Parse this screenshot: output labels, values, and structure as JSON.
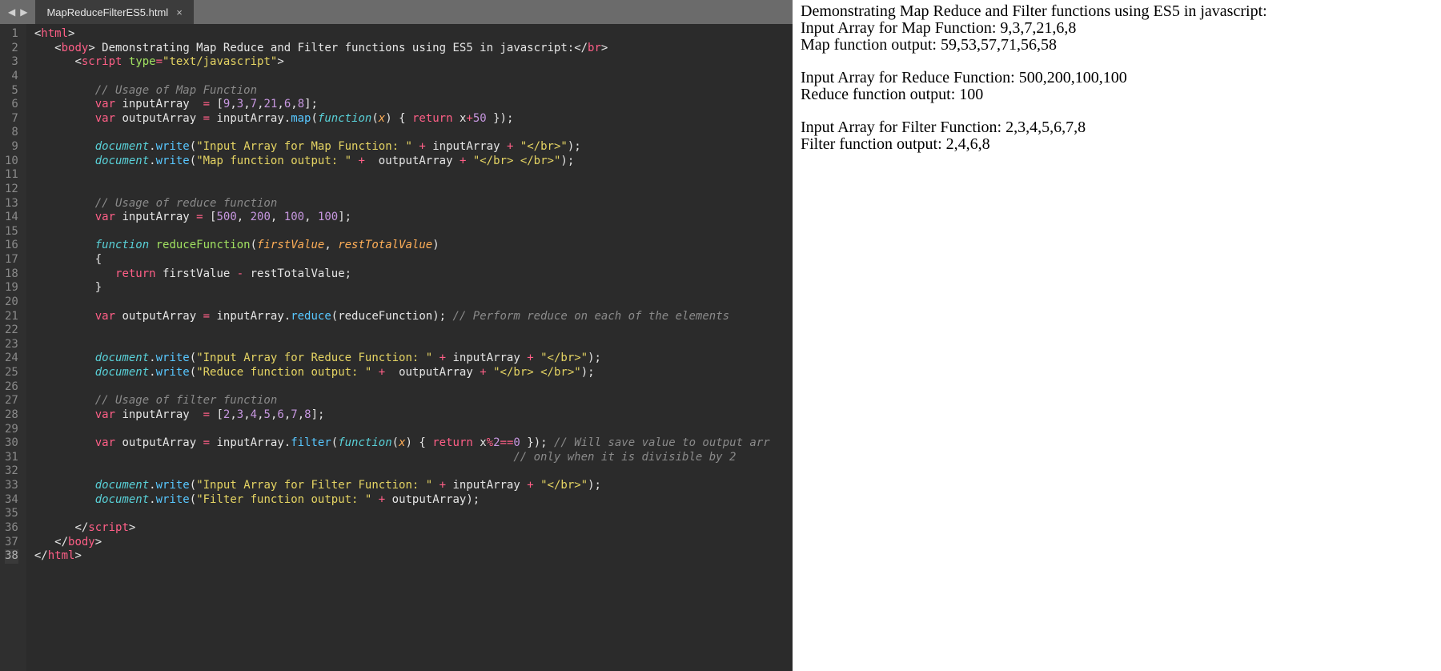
{
  "tab": {
    "title": "MapReduceFilterES5.html",
    "close_glyph": "×"
  },
  "nav": {
    "left": "◀",
    "right": "▶"
  },
  "gutter_lines": 38,
  "code_lines": [
    [
      [
        "c-punc",
        "<"
      ],
      [
        "c-tag",
        "html"
      ],
      [
        "c-punc",
        ">"
      ]
    ],
    [
      [
        "",
        "   "
      ],
      [
        "c-punc",
        "<"
      ],
      [
        "c-tag",
        "body"
      ],
      [
        "c-punc",
        "> "
      ],
      [
        "c-default",
        "Demonstrating Map Reduce and Filter functions using ES5 in javascript:"
      ],
      [
        "c-punc",
        "</"
      ],
      [
        "c-tag",
        "br"
      ],
      [
        "c-punc",
        ">"
      ]
    ],
    [
      [
        "",
        "      "
      ],
      [
        "c-punc",
        "<"
      ],
      [
        "c-tag",
        "script "
      ],
      [
        "c-attr",
        "type"
      ],
      [
        "c-op",
        "="
      ],
      [
        "c-string",
        "\"text/javascript\""
      ],
      [
        "c-punc",
        ">"
      ]
    ],
    [
      [
        "",
        ""
      ]
    ],
    [
      [
        "",
        "         "
      ],
      [
        "c-comment",
        "// Usage of Map Function"
      ]
    ],
    [
      [
        "",
        "         "
      ],
      [
        "c-tag",
        "var"
      ],
      [
        "c-default",
        " inputArray  "
      ],
      [
        "c-op",
        "="
      ],
      [
        "c-default",
        " ["
      ],
      [
        "c-num",
        "9"
      ],
      [
        "c-punc",
        ","
      ],
      [
        "c-num",
        "3"
      ],
      [
        "c-punc",
        ","
      ],
      [
        "c-num",
        "7"
      ],
      [
        "c-punc",
        ","
      ],
      [
        "c-num",
        "21"
      ],
      [
        "c-punc",
        ","
      ],
      [
        "c-num",
        "6"
      ],
      [
        "c-punc",
        ","
      ],
      [
        "c-num",
        "8"
      ],
      [
        "c-default",
        "];"
      ]
    ],
    [
      [
        "",
        "         "
      ],
      [
        "c-tag",
        "var"
      ],
      [
        "c-default",
        " outputArray "
      ],
      [
        "c-op",
        "="
      ],
      [
        "c-default",
        " inputArray."
      ],
      [
        "c-method",
        "map"
      ],
      [
        "c-default",
        "("
      ],
      [
        "c-func-it",
        "function"
      ],
      [
        "c-default",
        "("
      ],
      [
        "c-param",
        "x"
      ],
      [
        "c-default",
        ") { "
      ],
      [
        "c-tag",
        "return"
      ],
      [
        "c-default",
        " x"
      ],
      [
        "c-op",
        "+"
      ],
      [
        "c-num",
        "50"
      ],
      [
        "c-default",
        " });"
      ]
    ],
    [
      [
        "",
        ""
      ]
    ],
    [
      [
        "",
        "         "
      ],
      [
        "c-func-it",
        "document"
      ],
      [
        "c-default",
        "."
      ],
      [
        "c-method",
        "write"
      ],
      [
        "c-default",
        "("
      ],
      [
        "c-string",
        "\"Input Array for Map Function: \""
      ],
      [
        "c-default",
        " "
      ],
      [
        "c-op",
        "+"
      ],
      [
        "c-default",
        " inputArray "
      ],
      [
        "c-op",
        "+"
      ],
      [
        "c-default",
        " "
      ],
      [
        "c-string",
        "\"</br>\""
      ],
      [
        "c-default",
        ");"
      ]
    ],
    [
      [
        "",
        "         "
      ],
      [
        "c-func-it",
        "document"
      ],
      [
        "c-default",
        "."
      ],
      [
        "c-method",
        "write"
      ],
      [
        "c-default",
        "("
      ],
      [
        "c-string",
        "\"Map function output: \""
      ],
      [
        "c-default",
        " "
      ],
      [
        "c-op",
        "+"
      ],
      [
        "c-default",
        "  outputArray "
      ],
      [
        "c-op",
        "+"
      ],
      [
        "c-default",
        " "
      ],
      [
        "c-string",
        "\"</br> </br>\""
      ],
      [
        "c-default",
        ");"
      ]
    ],
    [
      [
        "",
        ""
      ]
    ],
    [
      [
        "",
        ""
      ]
    ],
    [
      [
        "",
        "         "
      ],
      [
        "c-comment",
        "// Usage of reduce function"
      ]
    ],
    [
      [
        "",
        "         "
      ],
      [
        "c-tag",
        "var"
      ],
      [
        "c-default",
        " inputArray "
      ],
      [
        "c-op",
        "="
      ],
      [
        "c-default",
        " ["
      ],
      [
        "c-num",
        "500"
      ],
      [
        "c-punc",
        ", "
      ],
      [
        "c-num",
        "200"
      ],
      [
        "c-punc",
        ", "
      ],
      [
        "c-num",
        "100"
      ],
      [
        "c-punc",
        ", "
      ],
      [
        "c-num",
        "100"
      ],
      [
        "c-default",
        "];"
      ]
    ],
    [
      [
        "",
        ""
      ]
    ],
    [
      [
        "",
        "         "
      ],
      [
        "c-func-it",
        "function"
      ],
      [
        "c-default",
        " "
      ],
      [
        "c-attr",
        "reduceFunction"
      ],
      [
        "c-default",
        "("
      ],
      [
        "c-param",
        "firstValue"
      ],
      [
        "c-punc",
        ", "
      ],
      [
        "c-param",
        "restTotalValue"
      ],
      [
        "c-default",
        ")"
      ]
    ],
    [
      [
        "",
        "         {"
      ]
    ],
    [
      [
        "",
        "            "
      ],
      [
        "c-tag",
        "return"
      ],
      [
        "c-default",
        " firstValue "
      ],
      [
        "c-op",
        "-"
      ],
      [
        "c-default",
        " restTotalValue;"
      ]
    ],
    [
      [
        "",
        "         }"
      ]
    ],
    [
      [
        "",
        ""
      ]
    ],
    [
      [
        "",
        "         "
      ],
      [
        "c-tag",
        "var"
      ],
      [
        "c-default",
        " outputArray "
      ],
      [
        "c-op",
        "="
      ],
      [
        "c-default",
        " inputArray."
      ],
      [
        "c-method",
        "reduce"
      ],
      [
        "c-default",
        "(reduceFunction); "
      ],
      [
        "c-comment",
        "// Perform reduce on each of the elements"
      ]
    ],
    [
      [
        "",
        ""
      ]
    ],
    [
      [
        "",
        ""
      ]
    ],
    [
      [
        "",
        "         "
      ],
      [
        "c-func-it",
        "document"
      ],
      [
        "c-default",
        "."
      ],
      [
        "c-method",
        "write"
      ],
      [
        "c-default",
        "("
      ],
      [
        "c-string",
        "\"Input Array for Reduce Function: \""
      ],
      [
        "c-default",
        " "
      ],
      [
        "c-op",
        "+"
      ],
      [
        "c-default",
        " inputArray "
      ],
      [
        "c-op",
        "+"
      ],
      [
        "c-default",
        " "
      ],
      [
        "c-string",
        "\"</br>\""
      ],
      [
        "c-default",
        ");"
      ]
    ],
    [
      [
        "",
        "         "
      ],
      [
        "c-func-it",
        "document"
      ],
      [
        "c-default",
        "."
      ],
      [
        "c-method",
        "write"
      ],
      [
        "c-default",
        "("
      ],
      [
        "c-string",
        "\"Reduce function output: \""
      ],
      [
        "c-default",
        " "
      ],
      [
        "c-op",
        "+"
      ],
      [
        "c-default",
        "  outputArray "
      ],
      [
        "c-op",
        "+"
      ],
      [
        "c-default",
        " "
      ],
      [
        "c-string",
        "\"</br> </br>\""
      ],
      [
        "c-default",
        ");"
      ]
    ],
    [
      [
        "",
        ""
      ]
    ],
    [
      [
        "",
        "         "
      ],
      [
        "c-comment",
        "// Usage of filter function"
      ]
    ],
    [
      [
        "",
        "         "
      ],
      [
        "c-tag",
        "var"
      ],
      [
        "c-default",
        " inputArray  "
      ],
      [
        "c-op",
        "="
      ],
      [
        "c-default",
        " ["
      ],
      [
        "c-num",
        "2"
      ],
      [
        "c-punc",
        ","
      ],
      [
        "c-num",
        "3"
      ],
      [
        "c-punc",
        ","
      ],
      [
        "c-num",
        "4"
      ],
      [
        "c-punc",
        ","
      ],
      [
        "c-num",
        "5"
      ],
      [
        "c-punc",
        ","
      ],
      [
        "c-num",
        "6"
      ],
      [
        "c-punc",
        ","
      ],
      [
        "c-num",
        "7"
      ],
      [
        "c-punc",
        ","
      ],
      [
        "c-num",
        "8"
      ],
      [
        "c-default",
        "];"
      ]
    ],
    [
      [
        "",
        ""
      ]
    ],
    [
      [
        "",
        "         "
      ],
      [
        "c-tag",
        "var"
      ],
      [
        "c-default",
        " outputArray "
      ],
      [
        "c-op",
        "="
      ],
      [
        "c-default",
        " inputArray."
      ],
      [
        "c-method",
        "filter"
      ],
      [
        "c-default",
        "("
      ],
      [
        "c-func-it",
        "function"
      ],
      [
        "c-default",
        "("
      ],
      [
        "c-param",
        "x"
      ],
      [
        "c-default",
        ") { "
      ],
      [
        "c-tag",
        "return"
      ],
      [
        "c-default",
        " x"
      ],
      [
        "c-op",
        "%"
      ],
      [
        "c-num",
        "2"
      ],
      [
        "c-op",
        "=="
      ],
      [
        "c-num",
        "0"
      ],
      [
        "c-default",
        " }); "
      ],
      [
        "c-comment",
        "// Will save value to output arr"
      ]
    ],
    [
      [
        "",
        "                                                                       "
      ],
      [
        "c-comment",
        "// only when it is divisible by 2"
      ]
    ],
    [
      [
        "",
        ""
      ]
    ],
    [
      [
        "",
        "         "
      ],
      [
        "c-func-it",
        "document"
      ],
      [
        "c-default",
        "."
      ],
      [
        "c-method",
        "write"
      ],
      [
        "c-default",
        "("
      ],
      [
        "c-string",
        "\"Input Array for Filter Function: \""
      ],
      [
        "c-default",
        " "
      ],
      [
        "c-op",
        "+"
      ],
      [
        "c-default",
        " inputArray "
      ],
      [
        "c-op",
        "+"
      ],
      [
        "c-default",
        " "
      ],
      [
        "c-string",
        "\"</br>\""
      ],
      [
        "c-default",
        ");"
      ]
    ],
    [
      [
        "",
        "         "
      ],
      [
        "c-func-it",
        "document"
      ],
      [
        "c-default",
        "."
      ],
      [
        "c-method",
        "write"
      ],
      [
        "c-default",
        "("
      ],
      [
        "c-string",
        "\"Filter function output: \""
      ],
      [
        "c-default",
        " "
      ],
      [
        "c-op",
        "+"
      ],
      [
        "c-default",
        " outputArray);"
      ]
    ],
    [
      [
        "",
        ""
      ]
    ],
    [
      [
        "",
        "      "
      ],
      [
        "c-punc",
        "</"
      ],
      [
        "c-tag",
        "script"
      ],
      [
        "c-punc",
        ">"
      ]
    ],
    [
      [
        "",
        "   "
      ],
      [
        "c-punc",
        "</"
      ],
      [
        "c-tag",
        "body"
      ],
      [
        "c-punc",
        ">"
      ]
    ],
    [
      [
        "c-punc",
        "</"
      ],
      [
        "c-tag",
        "html"
      ],
      [
        "c-punc",
        ">"
      ]
    ]
  ],
  "preview": {
    "lines": [
      "Demonstrating Map Reduce and Filter functions using ES5 in javascript:",
      "Input Array for Map Function: 9,3,7,21,6,8",
      "Map function output: 59,53,57,71,56,58",
      "",
      "Input Array for Reduce Function: 500,200,100,100",
      "Reduce function output: 100",
      "",
      "Input Array for Filter Function: 2,3,4,5,6,7,8",
      "Filter function output: 2,4,6,8"
    ]
  }
}
